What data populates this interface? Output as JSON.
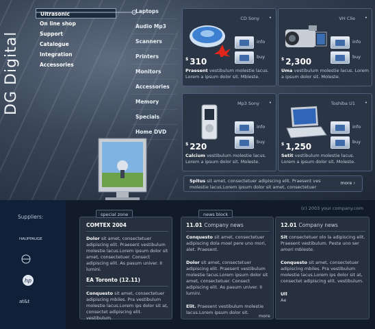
{
  "brand": "DG Digital",
  "left_nav": [
    "Ultrasonic",
    "On line shop",
    "Support",
    "Catalogue",
    "Integration",
    "Accessories"
  ],
  "categories": [
    "Laptops",
    "Audio Mp3",
    "Scanners",
    "Printers",
    "Monitors",
    "Accessories",
    "Memory",
    "Specials",
    "Home DVD"
  ],
  "products": [
    {
      "name": "CD Sony",
      "price": "310",
      "currency": "$",
      "info": "info",
      "buy": "buy",
      "menu": "•",
      "title": "Praesent",
      "desc": " vestibulum molestie lacus. Lorem a ipsum dolor sit. Mbleste."
    },
    {
      "name": "VH Clie",
      "price": "2,300",
      "currency": "$",
      "info": "info",
      "buy": "buy",
      "menu": "•",
      "title": "Uma",
      "desc": " vestibulum molestie lacus. Lorem a ipsum dolor sit. Moleste."
    },
    {
      "name": "Mp3 Sony",
      "price": "220",
      "currency": "$",
      "info": "info",
      "buy": "buy",
      "menu": "•",
      "title": "Calcium",
      "desc": " vestibulum molestie lacus. Lorem a ipsum dolor sit. Moleste."
    },
    {
      "name": "Toshiba U1",
      "price": "1,250",
      "currency": "$",
      "info": "info",
      "buy": "buy",
      "menu": "•",
      "title": "Setit",
      "desc": " vestibulum molestie lacus. Lorem a ipsum dolor sit. Moleste."
    }
  ],
  "promo": {
    "title": "Spitus",
    "text": " sit amet, consectetuer adipiscing elit. Praesent ves molestie lacus.Lorem ipsum dolor sit amet, consectetuer",
    "more": "more"
  },
  "copyright": "(c) 2003 your company.com",
  "suppliers": {
    "title": "Suppliers:",
    "logos": [
      "HAUPPAUGE",
      "",
      "hp",
      "at&t"
    ]
  },
  "special_zone": {
    "tab": "special zone",
    "item1": {
      "title": "COMTEX 2004",
      "lead": "Dolor",
      "text": " sit amet, consectetuer adipiscing elit. Praesent vestibulum molestie lacus.Lorem ipsum dolor sit amet, consectetuer. Consect adipiscing elit. As pasum univer. II lumini."
    },
    "item2": {
      "title": "EA Toronto (12.11)",
      "lead": "Conquesto",
      "text": " sit amet, consectetuer adipiscing mbiles. Pra vestibulum molestie lacus.Lorem ips dolor sit at, consectet adipiscing elit. vestibulum."
    }
  },
  "news_block": {
    "tab": "news block",
    "col1": {
      "date": "11.01",
      "label": "Company news",
      "p1_lead": "Conquesto",
      "p1": " sit amet, consectetuer adipiscing dola moel pere uno mori, alet. Praesent.",
      "p2_lead": "Dolor",
      "p2": " sit amet, consectetuer adipiscing elit. Praesent vestibulum molestie lacus.Lorem ipsum dolor sit amet, consectetuer. Consect adipiscing elit. As pasum univer. II lumini.",
      "p3_lead": "Elit.",
      "p3": " Praesent vestibulum molestie lacus.Lorem ipsum dolor sit.",
      "more": "more"
    },
    "col2": {
      "date": "12.01",
      "label": "Company news",
      "p1_lead": "Sit",
      "p1": " consectetuer olo la adipiscing elit. Praesent vestibulum. Peste uno ser amori mbleste.",
      "p2_lead": "Conquesto",
      "p2": " sit amet, consectetuer adipiscing mbiles. Pra vestibulum molestie lacus.Lorem ips dolor sit at, consectet adipiscing elit. vestibulum.",
      "p3_lead": "Ull",
      "p3": "",
      "p3b": "Ae"
    }
  },
  "colors": {
    "background": "#0d1520",
    "panel": "#2a3546",
    "accent": "#e8eef5"
  }
}
